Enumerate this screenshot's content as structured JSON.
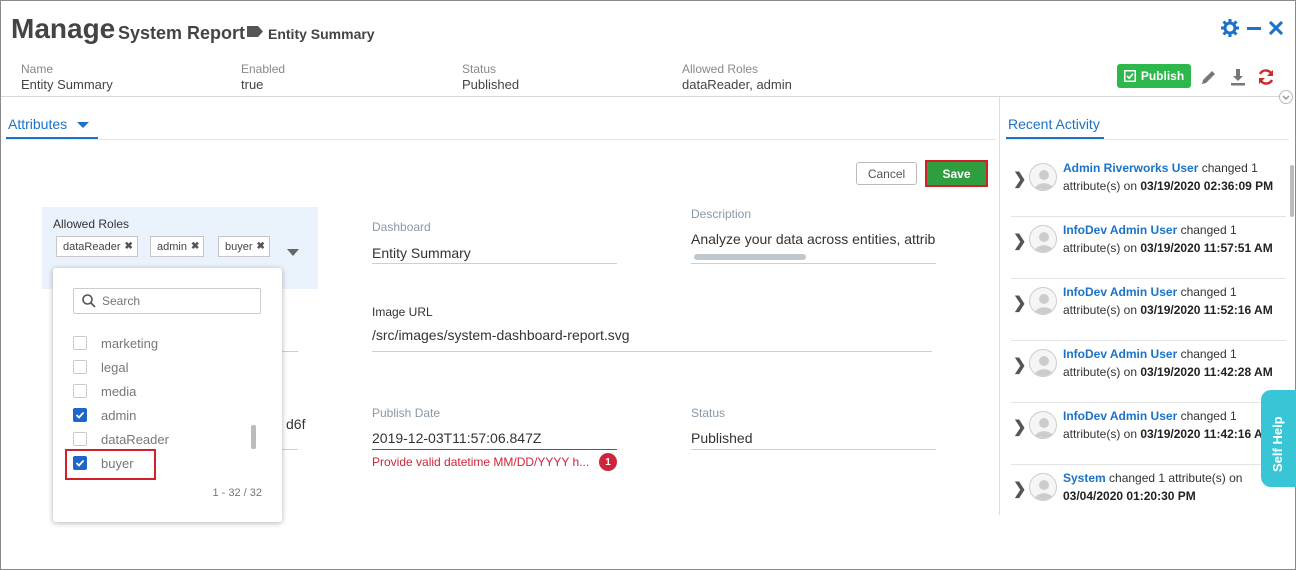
{
  "header": {
    "title": "Manage",
    "subtitle": "System Report",
    "entity": "Entity Summary"
  },
  "meta": [
    {
      "label": "Name",
      "value": "Entity Summary"
    },
    {
      "label": "Enabled",
      "value": "true"
    },
    {
      "label": "Status",
      "value": "Published"
    },
    {
      "label": "Allowed Roles",
      "value": "dataReader, admin"
    }
  ],
  "toolbar": {
    "publish_label": "Publish"
  },
  "tabs": {
    "attributes": "Attributes",
    "recent_activity": "Recent Activity"
  },
  "form": {
    "cancel_label": "Cancel",
    "save_label": "Save",
    "allowed_roles_label": "Allowed Roles",
    "chips": [
      "dataReader",
      "admin",
      "buyer"
    ],
    "dashboard_label": "Dashboard",
    "dashboard_value": "Entity Summary",
    "description_label": "Description",
    "description_value": "Analyze your data across entities, attribu",
    "image_url_label": "Image URL",
    "image_url_value": "/src/images/system-dashboard-report.svg",
    "publish_date_label": "Publish Date",
    "publish_date_value": "2019-12-03T11:57:06.847Z",
    "publish_date_error": "Provide valid datetime MM/DD/YYYY h...",
    "error_count": "1",
    "status_label": "Status",
    "status_value": "Published",
    "hidden_field_tail": "d6f"
  },
  "dropdown": {
    "search_placeholder": "Search",
    "options": [
      {
        "label": "marketing",
        "checked": false
      },
      {
        "label": "legal",
        "checked": false
      },
      {
        "label": "media",
        "checked": false
      },
      {
        "label": "admin",
        "checked": true
      },
      {
        "label": "dataReader",
        "checked": false
      },
      {
        "label": "buyer",
        "checked": true
      }
    ],
    "count": "1 - 32 / 32"
  },
  "activity": [
    {
      "user": "Admin Riverworks User",
      "text": " changed 1 attribute(s) on ",
      "when": "03/19/2020 02:36:09 PM"
    },
    {
      "user": "InfoDev Admin User",
      "text": " changed 1 attribute(s) on ",
      "when": "03/19/2020 11:57:51 AM"
    },
    {
      "user": "InfoDev Admin User",
      "text": " changed 1 attribute(s) on ",
      "when": "03/19/2020 11:52:16 AM"
    },
    {
      "user": "InfoDev Admin User",
      "text": " changed 1 attribute(s) on ",
      "when": "03/19/2020 11:42:28 AM"
    },
    {
      "user": "InfoDev Admin User",
      "text": " changed 1 attribute(s) on ",
      "when": "03/19/2020 11:42:16 AM"
    },
    {
      "user": "System",
      "text": " changed 1 attribute(s) on ",
      "when": "03/04/2020 01:20:30 PM"
    }
  ],
  "self_help": "Self Help",
  "colors": {
    "accent": "#1a73c8",
    "publish": "#2db84c",
    "save": "#2e9e3e",
    "error": "#d0243a",
    "self_help": "#38c6d6"
  }
}
